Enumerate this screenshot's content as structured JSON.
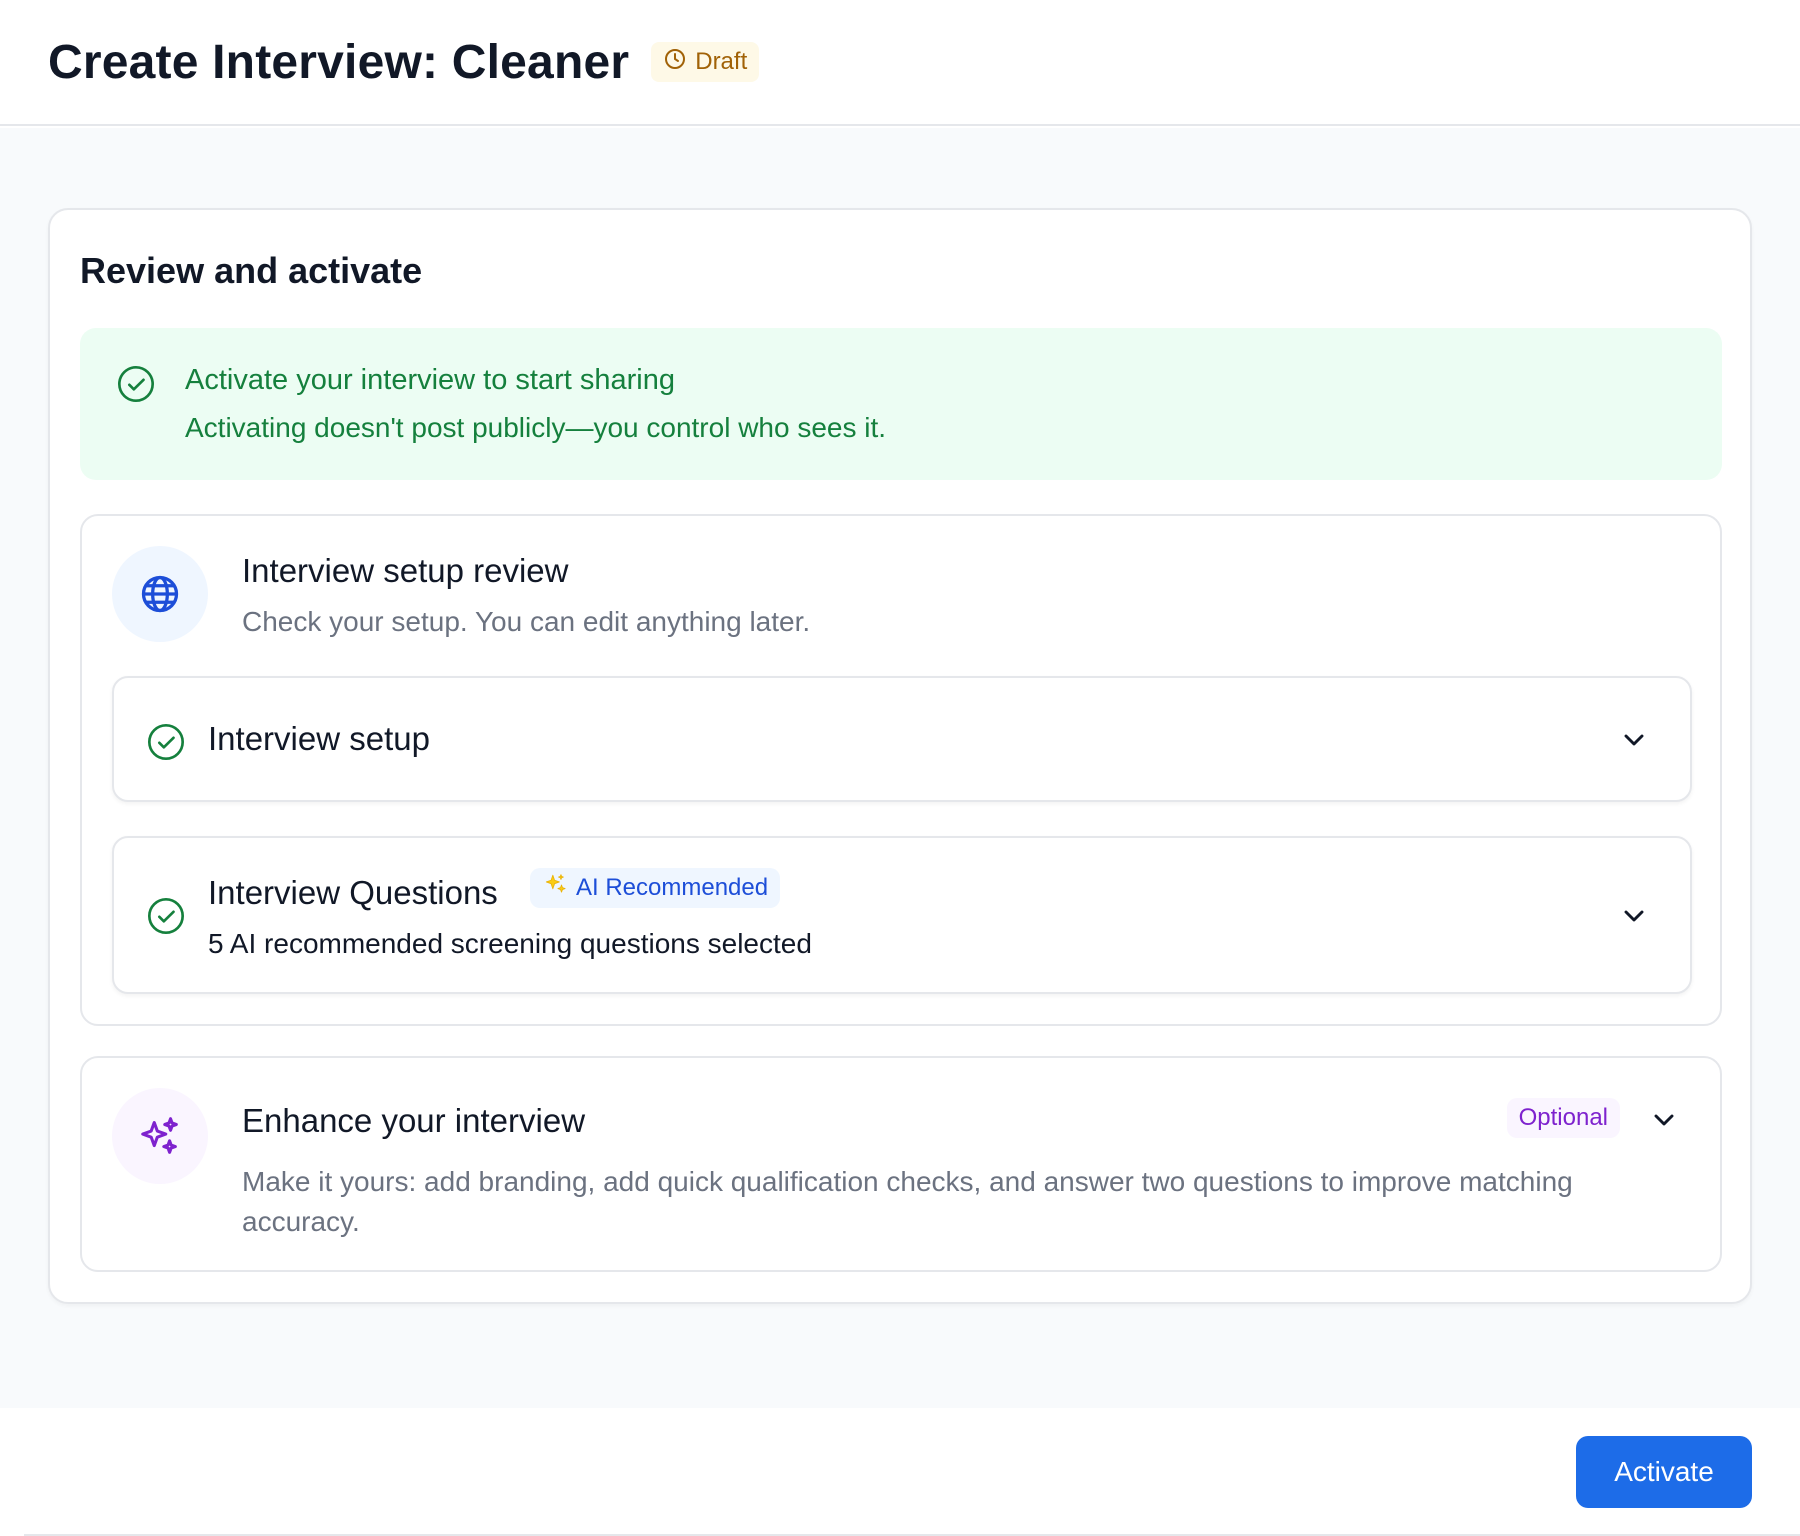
{
  "header": {
    "title": "Create Interview: Cleaner",
    "status": "Draft"
  },
  "card": {
    "title": "Review and activate",
    "alert": {
      "title": "Activate your interview to start sharing",
      "body": "Activating doesn't post publicly—you control who sees it."
    },
    "review": {
      "icon": "globe-icon",
      "title": "Interview setup review",
      "subtitle": "Check your setup. You can edit anything later.",
      "items": [
        {
          "title": "Interview setup"
        },
        {
          "title": "Interview Questions",
          "badge": "AI Recommended",
          "description": "5 AI recommended screening questions selected"
        }
      ]
    },
    "enhance": {
      "icon": "sparkles-icon",
      "title": "Enhance your interview",
      "badge": "Optional",
      "description": "Make it yours: add branding, add quick qualification checks, and answer two questions to improve matching accuracy."
    }
  },
  "footer": {
    "activate_label": "Activate"
  },
  "colors": {
    "accent": "#1d6ce8",
    "success": "#15803d",
    "draft": "#a16207",
    "ai": "#1d4ed8",
    "optional": "#7e22ce"
  }
}
